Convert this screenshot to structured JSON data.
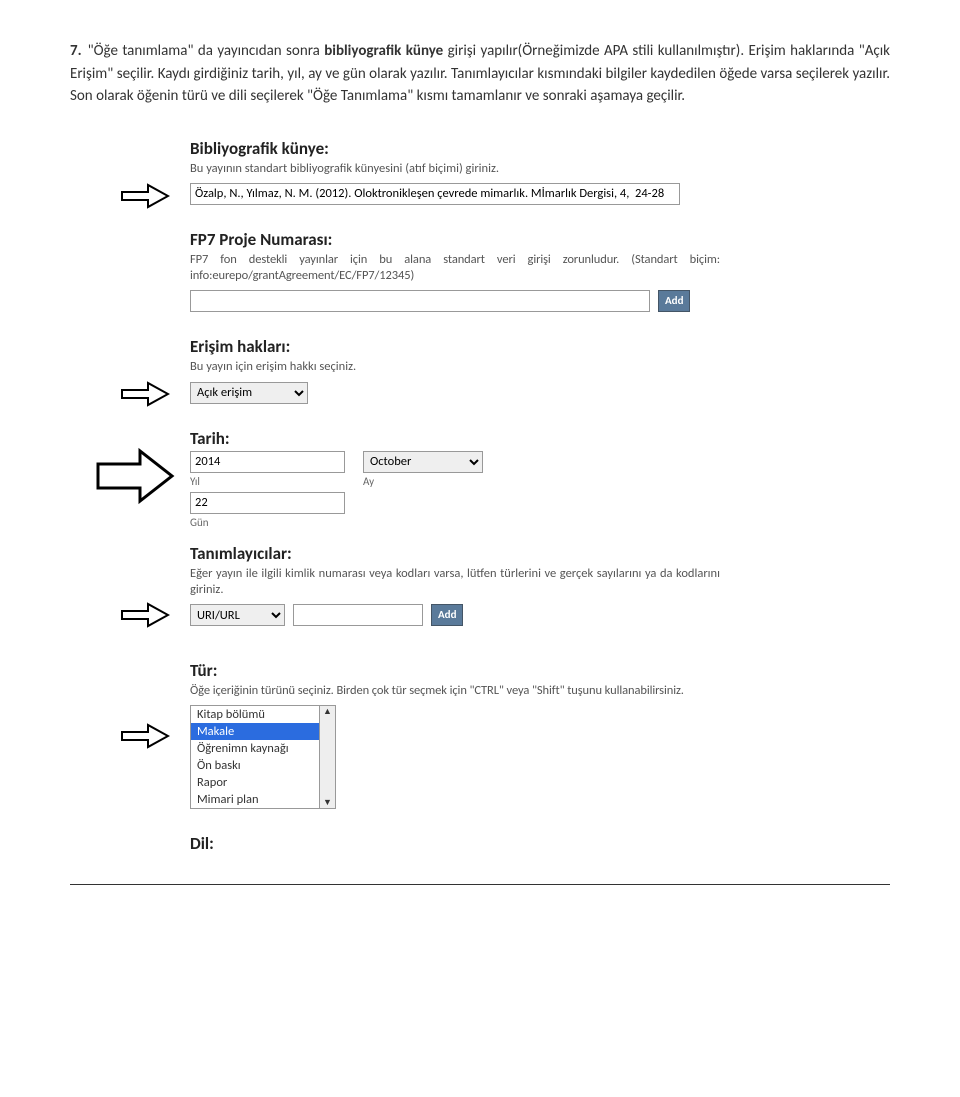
{
  "intro": {
    "num": "7.",
    "t1": "\"Öğe tanımlama\"",
    "t2": " da yayıncıdan sonra ",
    "bold": "bibliyografik künye",
    "t3": " girişi yapılır(Örneğimizde APA stili kullanılmıştır). Erişim haklarında \"Açık Erişim\" seçilir. Kaydı girdiğiniz tarih, yıl, ay ve gün olarak yazılır. Tanımlayıcılar kısmındaki bilgiler kaydedilen öğede varsa seçilerek yazılır. Son olarak öğenin türü ve dili seçilerek \"Öğe Tanımlama\" kısmı tamamlanır ve sonraki aşamaya geçilir."
  },
  "biblio": {
    "heading": "Bibliyografik künye:",
    "desc": "Bu yayının standart bibliyografik künyesini (atıf biçimi) giriniz.",
    "value": "Özalp, N., Yılmaz, N. M. (2012). Oloktronikleşen çevrede mimarlık. Mİmarlık Dergisi, 4,  24-28"
  },
  "fp7": {
    "heading": "FP7 Proje Numarası:",
    "desc": "FP7 fon destekli yayınlar için bu alana standart veri girişi zorunludur. (Standart biçim: info:eurepo/grantAgreement/EC/FP7/12345)",
    "add": "Add"
  },
  "access": {
    "heading": "Erişim hakları:",
    "desc": "Bu yayın için erişim hakkı seçiniz.",
    "value": "Açık erişim"
  },
  "date": {
    "heading": "Tarih:",
    "year": "2014",
    "month": "October",
    "day": "22",
    "year_lbl": "Yıl",
    "month_lbl": "Ay",
    "day_lbl": "Gün"
  },
  "idents": {
    "heading": "Tanımlayıcılar:",
    "desc": "Eğer yayın ile ilgili kimlik numarası veya kodları varsa, lütfen türlerini ve gerçek sayılarını ya da kodlarını giriniz.",
    "type": "URI/URL",
    "add": "Add"
  },
  "type": {
    "heading": "Tür:",
    "desc": "Öğe içeriğinin türünü seçiniz. Birden çok tür seçmek için \"CTRL\" veya \"Shift\" tuşunu kullanabilirsiniz.",
    "opts": [
      "Kitap bölümü",
      "Makale",
      "Öğrenimn kaynağı",
      "Ön baskı",
      "Rapor",
      "Mimari plan"
    ]
  },
  "lang": {
    "heading": "Dil:"
  }
}
